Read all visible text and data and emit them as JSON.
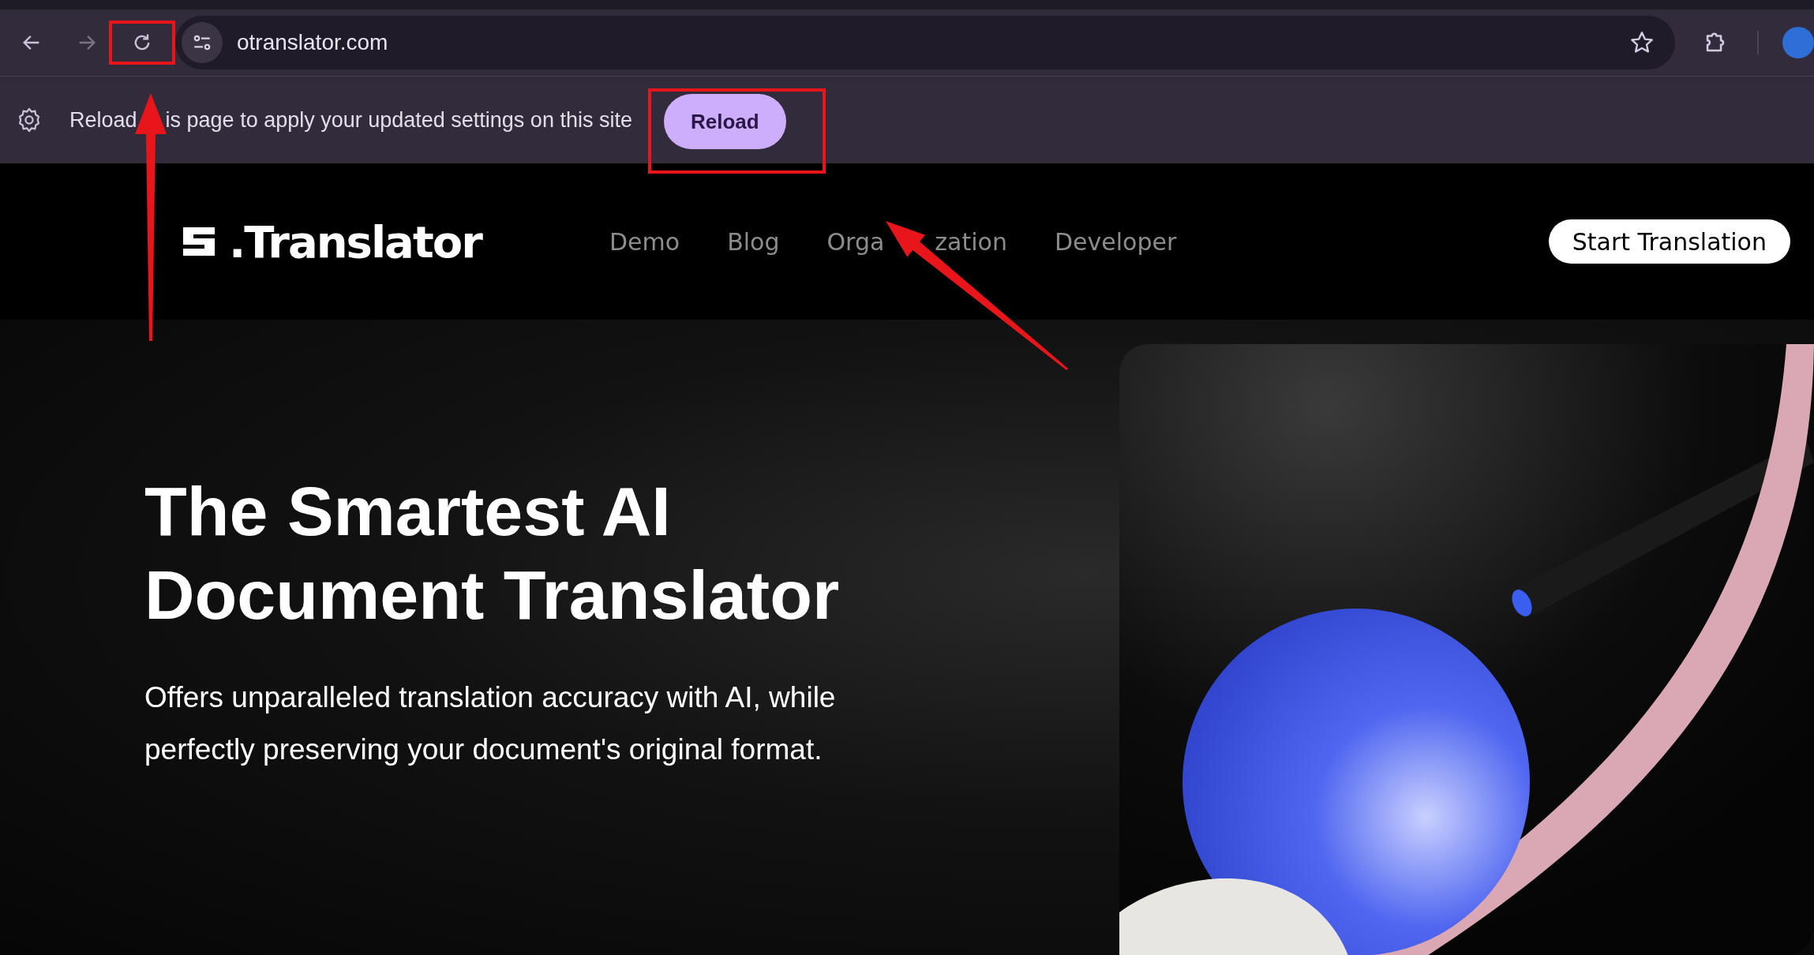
{
  "browser": {
    "buttons": [
      {
        "kind": "back",
        "disabled": false,
        "highlighted": false,
        "arrow": false
      },
      {
        "kind": "forward",
        "disabled": true,
        "highlighted": false,
        "arrow": false
      },
      {
        "kind": "reload",
        "disabled": false,
        "highlighted": true,
        "arrow": true
      }
    ],
    "url": "otranslator.com"
  },
  "infobar": {
    "message_parts": [
      "Reload",
      "is page to apply your updated settings on this site"
    ],
    "button": "Reload",
    "button_highlighted": true,
    "button_arrow": true
  },
  "site": {
    "logo": ".Translator",
    "nav": [
      {
        "parts": [
          "Demo"
        ]
      },
      {
        "parts": [
          "Blog"
        ]
      },
      {
        "parts": [
          "Orga",
          "zation"
        ]
      },
      {
        "parts": [
          "Developer"
        ]
      }
    ],
    "cta": "Start Translation",
    "hero": {
      "title_lines": [
        "The Smartest AI",
        "Document Translator"
      ],
      "subtitle_lines": [
        "Offers unparalleled translation accuracy with AI, while",
        "perfectly preserving your document's original format."
      ]
    }
  }
}
